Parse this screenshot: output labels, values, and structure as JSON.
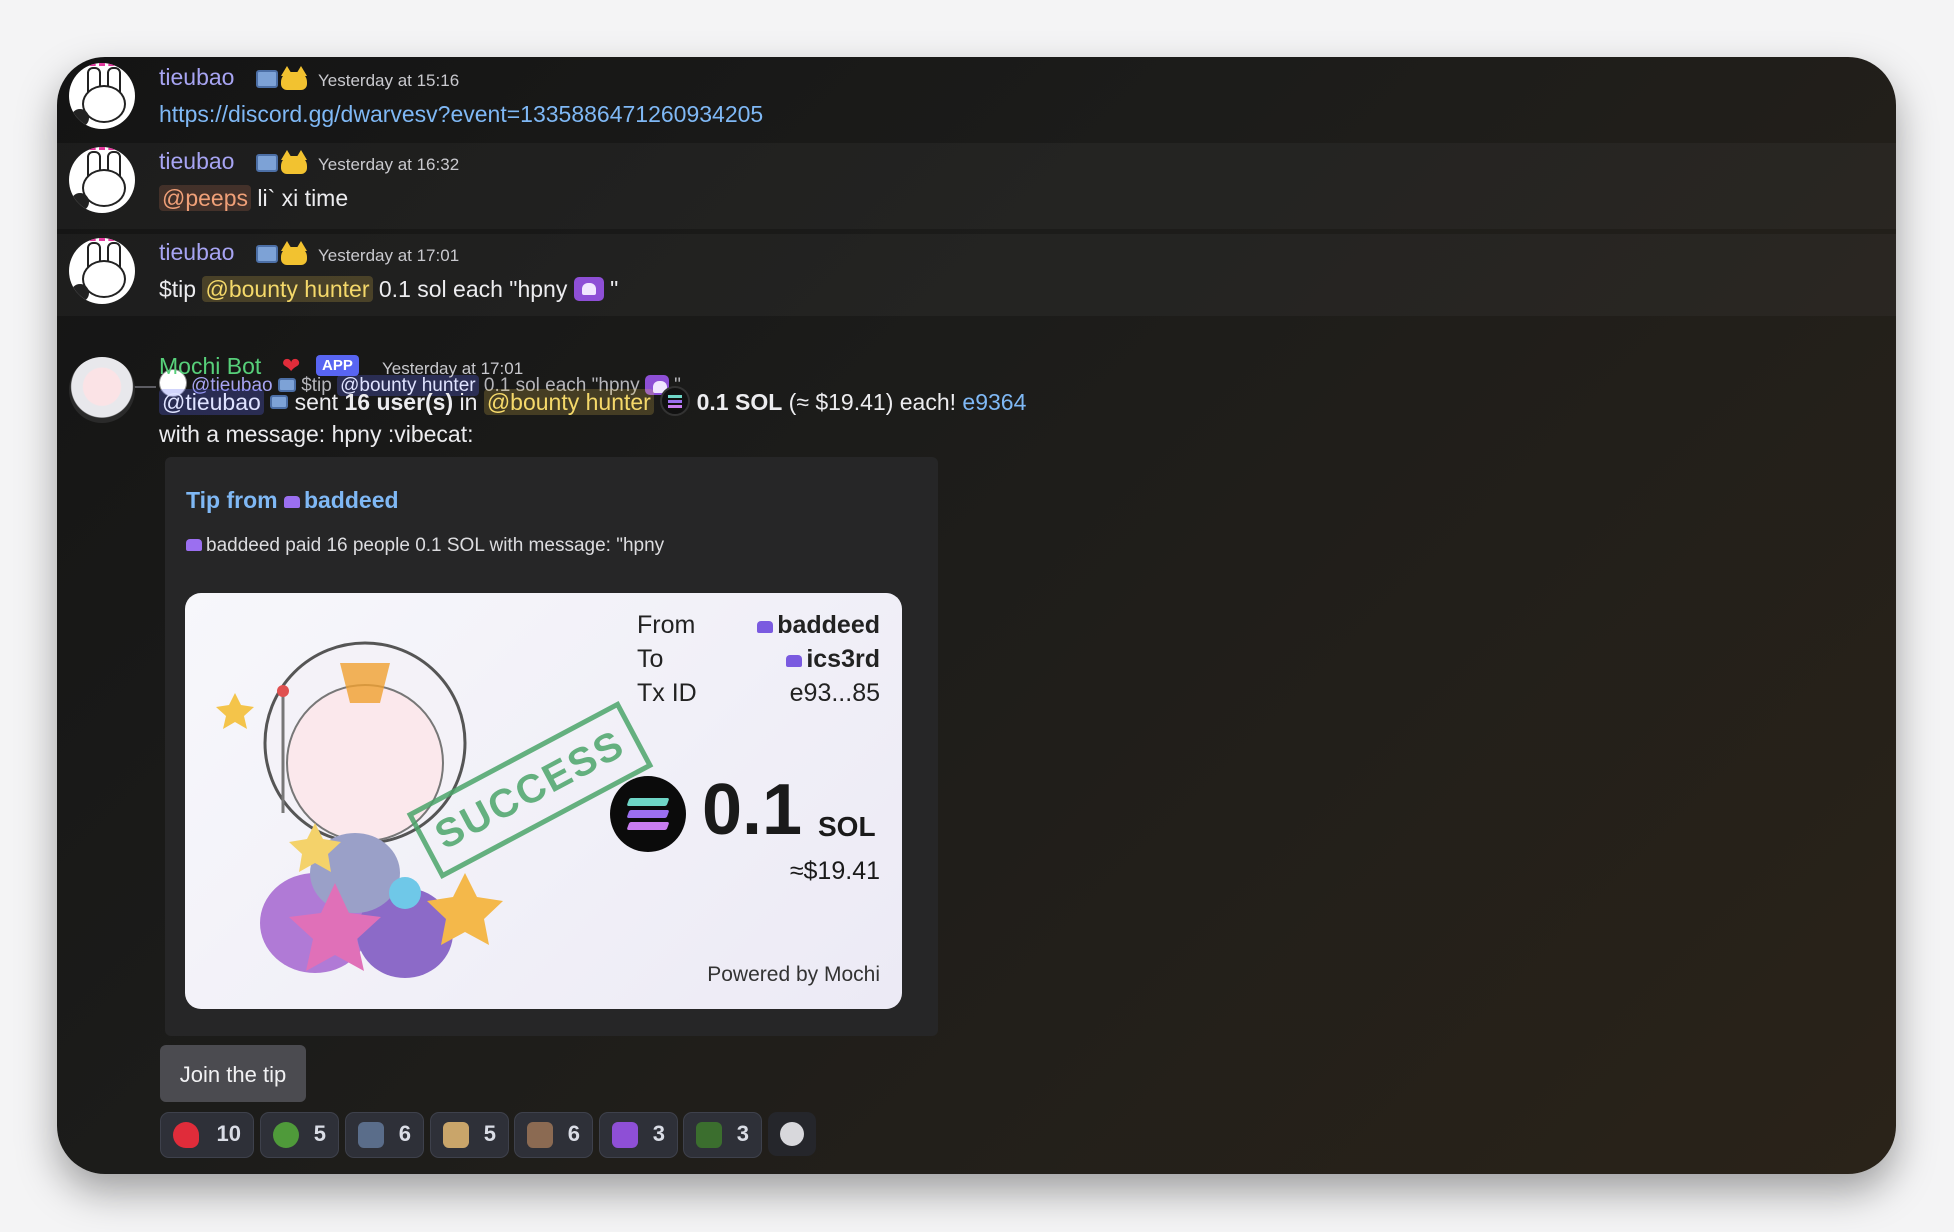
{
  "messages": [
    {
      "username": "tieubao",
      "timestamp": "Yesterday at 15:16",
      "content": "https://discord.gg/dwarvesv?event=1335886471260934205"
    },
    {
      "username": "tieubao",
      "timestamp": "Yesterday at 16:32",
      "mention": "@peeps",
      "content": "li` xi time"
    },
    {
      "username": "tieubao",
      "timestamp": "Yesterday at 17:01",
      "prefix": "$tip",
      "mention": "@bounty hunter",
      "content": "0.1 sol each \"hpny",
      "suffix": "\""
    }
  ],
  "reply": {
    "username": "@tieubao",
    "prefix": "$tip",
    "mention": "@bounty hunter",
    "content": "0.1 sol each \"hpny",
    "suffix": "\""
  },
  "bot": {
    "name": "Mochi Bot",
    "badge": "APP",
    "timestamp": "Yesterday at 17:01",
    "mention_user": "@tieubao",
    "sent": "sent",
    "count": "16 user(s)",
    "in": "in",
    "mention_role": "@bounty hunter",
    "amount": "0.1 SOL",
    "usd_each": "(≈ $19.41) each!",
    "tx_link": "e9364",
    "message_line": "with a message: hpny :vibecat:"
  },
  "embed": {
    "title_prefix": "Tip from",
    "title_user": "baddeed",
    "description": "baddeed paid 16 people 0.1 SOL with message: \"hpny",
    "receipt": {
      "from_label": "From",
      "from_value": "baddeed",
      "to_label": "To",
      "to_value": "ics3rd",
      "tx_label": "Tx ID",
      "tx_value": "e93...85",
      "stamp": "SUCCESS",
      "amount": "0.1",
      "unit": "SOL",
      "usd": "≈$19.41",
      "powered": "Powered by Mochi"
    }
  },
  "button": {
    "label": "Join the tip"
  },
  "reactions": [
    {
      "emoji": "heart-icon",
      "count": "10",
      "color": "#e02c3a"
    },
    {
      "emoji": "pepe-icon",
      "count": "5",
      "color": "#4f9a3a"
    },
    {
      "emoji": "pepe-drawing-icon",
      "count": "6",
      "color": "#5a6d8a"
    },
    {
      "emoji": "cat-icon",
      "count": "5",
      "color": "#c9a56a"
    },
    {
      "emoji": "cat-photo-icon",
      "count": "6",
      "color": "#8b6a52"
    },
    {
      "emoji": "hpny-icon",
      "count": "3",
      "color": "#8e4fd6"
    },
    {
      "emoji": "pepe-hat-icon",
      "count": "3",
      "color": "#3b6e2e"
    }
  ],
  "colors": {
    "username": "#a7a4f2",
    "bot_name": "#57d07a",
    "link": "#7fb8f5",
    "app_badge": "#5865f2"
  }
}
